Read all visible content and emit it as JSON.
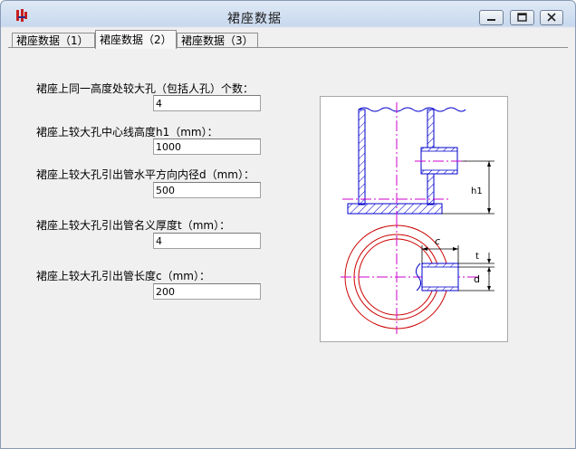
{
  "window": {
    "title": "裙座数据"
  },
  "tabs": [
    {
      "label": "裙座数据（1）"
    },
    {
      "label": "裙座数据（2）"
    },
    {
      "label": "裙座数据（3）"
    }
  ],
  "active_tab": 1,
  "fields": [
    {
      "label": "裙座上同一高度处较大孔（包括人孔）个数：",
      "value": "4"
    },
    {
      "label": "裙座上较大孔中心线高度h1（mm）：",
      "value": "1000"
    },
    {
      "label": "裙座上较大孔引出管水平方向内径d（mm）：",
      "value": "500"
    },
    {
      "label": "裙座上较大孔引出管名义厚度t（mm）：",
      "value": "4"
    },
    {
      "label": "裙座上较大孔引出管长度c（mm）：",
      "value": "200"
    }
  ],
  "diagram": {
    "labels": {
      "h1": "h1",
      "c": "c",
      "t": "t",
      "d": "d"
    },
    "colors": {
      "outline": "#0000cc",
      "hatch": "#0000cc",
      "center": "#cc00cc",
      "circle": "#cc0000",
      "dimension": "#000000"
    }
  }
}
